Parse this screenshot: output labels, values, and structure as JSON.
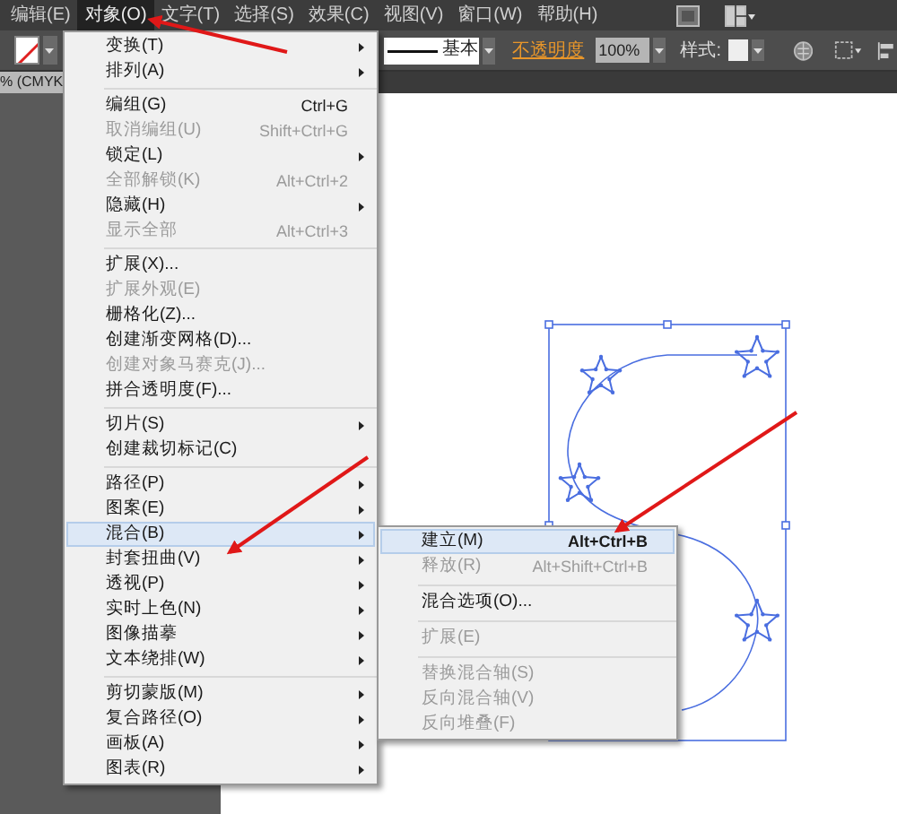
{
  "menubar": [
    {
      "label": "编辑(E)",
      "selected": false
    },
    {
      "label": "对象(O)",
      "selected": true
    },
    {
      "label": "文字(T)",
      "selected": false
    },
    {
      "label": "选择(S)",
      "selected": false
    },
    {
      "label": "效果(C)",
      "selected": false
    },
    {
      "label": "视图(V)",
      "selected": false
    },
    {
      "label": "窗口(W)",
      "selected": false
    },
    {
      "label": "帮助(H)",
      "selected": false
    }
  ],
  "toolbar": {
    "stroke_style": "基本",
    "opacity_label": "不透明度",
    "opacity_value": "100%",
    "style_label": "样式:"
  },
  "document_tab": {
    "title": "% (CMYK"
  },
  "object_menu": {
    "items": [
      {
        "kind": "item",
        "label": "变换(T)",
        "submenu": true,
        "disabled": false,
        "selected": false
      },
      {
        "kind": "item",
        "label": "排列(A)",
        "submenu": true,
        "disabled": false,
        "selected": false
      },
      {
        "kind": "separator"
      },
      {
        "kind": "item",
        "label": "编组(G)",
        "shortcut": "Ctrl+G",
        "submenu": false,
        "disabled": false,
        "selected": false
      },
      {
        "kind": "item",
        "label": "取消编组(U)",
        "shortcut": "Shift+Ctrl+G",
        "submenu": false,
        "disabled": true,
        "selected": false
      },
      {
        "kind": "item",
        "label": "锁定(L)",
        "submenu": true,
        "disabled": false,
        "selected": false
      },
      {
        "kind": "item",
        "label": "全部解锁(K)",
        "shortcut": "Alt+Ctrl+2",
        "submenu": false,
        "disabled": true,
        "selected": false
      },
      {
        "kind": "item",
        "label": "隐藏(H)",
        "submenu": true,
        "disabled": false,
        "selected": false
      },
      {
        "kind": "item",
        "label": "显示全部",
        "shortcut": "Alt+Ctrl+3",
        "submenu": false,
        "disabled": true,
        "selected": false
      },
      {
        "kind": "separator"
      },
      {
        "kind": "item",
        "label": "扩展(X)...",
        "submenu": false,
        "disabled": false,
        "selected": false
      },
      {
        "kind": "item",
        "label": "扩展外观(E)",
        "submenu": false,
        "disabled": true,
        "selected": false
      },
      {
        "kind": "item",
        "label": "栅格化(Z)...",
        "submenu": false,
        "disabled": false,
        "selected": false
      },
      {
        "kind": "item",
        "label": "创建渐变网格(D)...",
        "submenu": false,
        "disabled": false,
        "selected": false
      },
      {
        "kind": "item",
        "label": "创建对象马赛克(J)...",
        "submenu": false,
        "disabled": true,
        "selected": false
      },
      {
        "kind": "item",
        "label": "拼合透明度(F)...",
        "submenu": false,
        "disabled": false,
        "selected": false
      },
      {
        "kind": "separator"
      },
      {
        "kind": "item",
        "label": "切片(S)",
        "submenu": true,
        "disabled": false,
        "selected": false
      },
      {
        "kind": "item",
        "label": "创建裁切标记(C)",
        "submenu": false,
        "disabled": false,
        "selected": false
      },
      {
        "kind": "separator"
      },
      {
        "kind": "item",
        "label": "路径(P)",
        "submenu": true,
        "disabled": false,
        "selected": false
      },
      {
        "kind": "item",
        "label": "图案(E)",
        "submenu": true,
        "disabled": false,
        "selected": false
      },
      {
        "kind": "item",
        "label": "混合(B)",
        "submenu": true,
        "disabled": false,
        "selected": true
      },
      {
        "kind": "item",
        "label": "封套扭曲(V)",
        "submenu": true,
        "disabled": false,
        "selected": false
      },
      {
        "kind": "item",
        "label": "透视(P)",
        "submenu": true,
        "disabled": false,
        "selected": false
      },
      {
        "kind": "item",
        "label": "实时上色(N)",
        "submenu": true,
        "disabled": false,
        "selected": false
      },
      {
        "kind": "item",
        "label": "图像描摹",
        "submenu": true,
        "disabled": false,
        "selected": false
      },
      {
        "kind": "item",
        "label": "文本绕排(W)",
        "submenu": true,
        "disabled": false,
        "selected": false
      },
      {
        "kind": "separator"
      },
      {
        "kind": "item",
        "label": "剪切蒙版(M)",
        "submenu": true,
        "disabled": false,
        "selected": false
      },
      {
        "kind": "item",
        "label": "复合路径(O)",
        "submenu": true,
        "disabled": false,
        "selected": false
      },
      {
        "kind": "item",
        "label": "画板(A)",
        "submenu": true,
        "disabled": false,
        "selected": false
      },
      {
        "kind": "item",
        "label": "图表(R)",
        "submenu": true,
        "disabled": false,
        "selected": false
      }
    ]
  },
  "blend_submenu": {
    "items": [
      {
        "kind": "item",
        "label": "建立(M)",
        "shortcut": "Alt+Ctrl+B",
        "submenu": false,
        "disabled": false,
        "selected": true
      },
      {
        "kind": "item",
        "label": "释放(R)",
        "shortcut": "Alt+Shift+Ctrl+B",
        "submenu": false,
        "disabled": true,
        "selected": false
      },
      {
        "kind": "separator"
      },
      {
        "kind": "item",
        "label": "混合选项(O)...",
        "submenu": false,
        "disabled": false,
        "selected": false
      },
      {
        "kind": "separator"
      },
      {
        "kind": "item",
        "label": "扩展(E)",
        "submenu": false,
        "disabled": true,
        "selected": false
      },
      {
        "kind": "separator"
      },
      {
        "kind": "item",
        "label": "替换混合轴(S)",
        "submenu": false,
        "disabled": true,
        "selected": false
      },
      {
        "kind": "item",
        "label": "反向混合轴(V)",
        "submenu": false,
        "disabled": true,
        "selected": false
      },
      {
        "kind": "item",
        "label": "反向堆叠(F)",
        "submenu": false,
        "disabled": true,
        "selected": false
      }
    ]
  }
}
